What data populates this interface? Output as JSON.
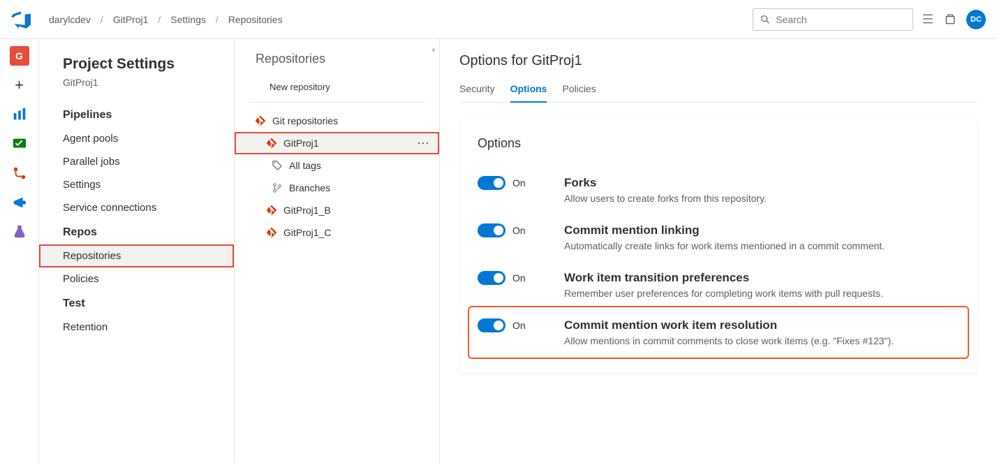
{
  "breadcrumb": [
    "darylcdev",
    "GitProj1",
    "Settings",
    "Repositories"
  ],
  "search": {
    "placeholder": "Search"
  },
  "avatar": "DC",
  "settings": {
    "title": "Project Settings",
    "project": "GitProj1",
    "sections": [
      {
        "name": "Pipelines",
        "items": [
          "Agent pools",
          "Parallel jobs",
          "Settings",
          "Service connections"
        ]
      },
      {
        "name": "Repos",
        "items": [
          "Repositories",
          "Policies"
        ],
        "selected": "Repositories"
      },
      {
        "name": "Test",
        "items": [
          "Retention"
        ]
      }
    ]
  },
  "repoPanel": {
    "title": "Repositories",
    "newRepo": "New repository",
    "root": "Git repositories",
    "selected": "GitProj1",
    "subItems": [
      "All tags",
      "Branches"
    ],
    "repos": [
      "GitProj1",
      "GitProj1_B",
      "GitProj1_C"
    ]
  },
  "main": {
    "title": "Options for GitProj1",
    "tabs": [
      "Security",
      "Options",
      "Policies"
    ],
    "activeTab": "Options",
    "cardTitle": "Options",
    "toggleLabel": "On",
    "options": [
      {
        "title": "Forks",
        "desc": "Allow users to create forks from this repository.",
        "on": true
      },
      {
        "title": "Commit mention linking",
        "desc": "Automatically create links for work items mentioned in a commit comment.",
        "on": true
      },
      {
        "title": "Work item transition preferences",
        "desc": "Remember user preferences for completing work items with pull requests.",
        "on": true
      },
      {
        "title": "Commit mention work item resolution",
        "desc": "Allow mentions in commit comments to close work items (e.g. \"Fixes #123\").",
        "on": true,
        "highlighted": true
      }
    ]
  }
}
